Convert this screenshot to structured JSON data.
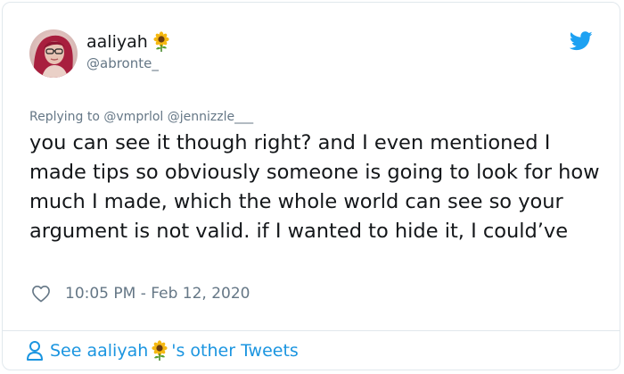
{
  "user": {
    "display_name": "aaliyah",
    "handle": "@abronte_",
    "name_emoji": "sunflower-icon"
  },
  "reply": {
    "prefix": "Replying to",
    "mentions": [
      "@vmprlol",
      "@jennizzle___"
    ]
  },
  "tweet": {
    "text": "you can see it though right? and I even mentioned I made tips so obviously someone is going to look for how much I made, which the whole world can see so your argument is not valid. if I wanted to hide it, I could’ve",
    "timestamp": "10:05 PM - Feb 12, 2020"
  },
  "footer": {
    "prefix": "See aaliyah",
    "suffix": "'s other Tweets"
  },
  "colors": {
    "twitter_blue": "#1da1f2",
    "link_blue": "#1b95e0",
    "muted_gray": "#657786",
    "text_dark": "#14171a",
    "border": "#e1e8ed"
  }
}
